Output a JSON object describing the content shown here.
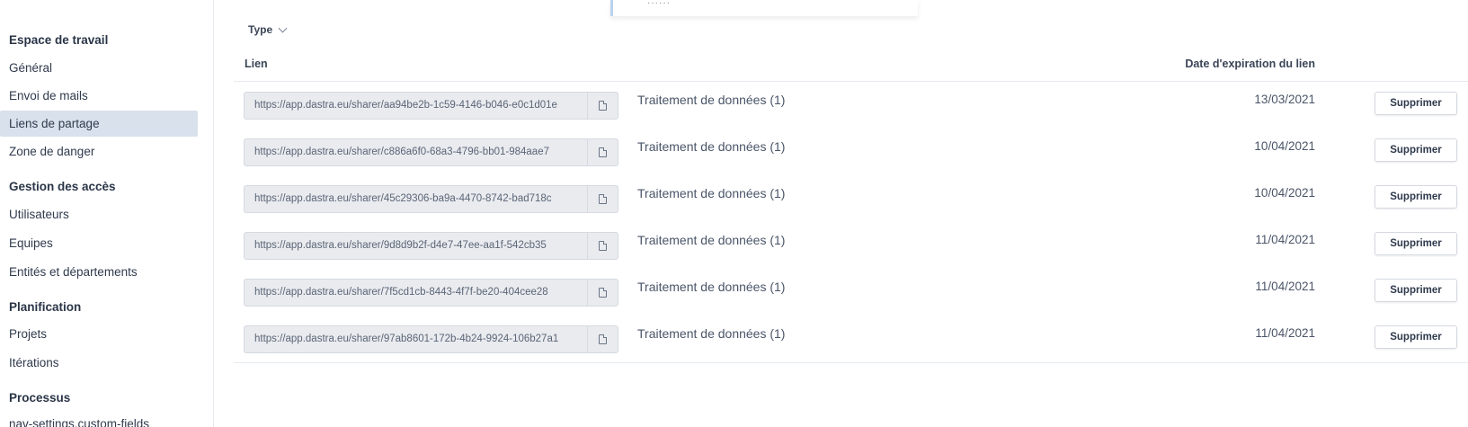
{
  "sidebar": {
    "sections": [
      {
        "title": "Espace de travail",
        "items": [
          "Général",
          "Envoi de mails",
          "Liens de partage",
          "Zone de danger"
        ]
      },
      {
        "title": "Gestion des accès",
        "items": [
          "Utilisateurs",
          "Equipes",
          "Entités et départements"
        ]
      },
      {
        "title": "Planification",
        "items": [
          "Projets",
          "Itérations"
        ]
      },
      {
        "title": "Processus",
        "items": [
          "nav-settings.custom-fields"
        ]
      }
    ],
    "active_item": "Liens de partage"
  },
  "popup": {
    "partial_text": "......"
  },
  "filter": {
    "label": "Type"
  },
  "table": {
    "headers": {
      "link": "Lien",
      "expiry": "Date d'expiration du lien"
    },
    "delete_label": "Supprimer",
    "rows": [
      {
        "url": "https://app.dastra.eu/sharer/aa94be2b-1c59-4146-b046-e0c1d01e",
        "object": "Traitement de données (1)",
        "date": "13/03/2021"
      },
      {
        "url": "https://app.dastra.eu/sharer/c886a6f0-68a3-4796-bb01-984aae7",
        "object": "Traitement de données (1)",
        "date": "10/04/2021"
      },
      {
        "url": "https://app.dastra.eu/sharer/45c29306-ba9a-4470-8742-bad718c",
        "object": "Traitement de données (1)",
        "date": "10/04/2021"
      },
      {
        "url": "https://app.dastra.eu/sharer/9d8d9b2f-d4e7-47ee-aa1f-542cb35",
        "object": "Traitement de données (1)",
        "date": "11/04/2021"
      },
      {
        "url": "https://app.dastra.eu/sharer/7f5cd1cb-8443-4f7f-be20-404cee28",
        "object": "Traitement de données (1)",
        "date": "11/04/2021"
      },
      {
        "url": "https://app.dastra.eu/sharer/97ab8601-172b-4b24-9924-106b27a1",
        "object": "Traitement de données (1)",
        "date": "11/04/2021"
      }
    ]
  },
  "icons": {
    "copy": "document-copy-icon",
    "filter_chevron": "chevron-down-icon"
  }
}
